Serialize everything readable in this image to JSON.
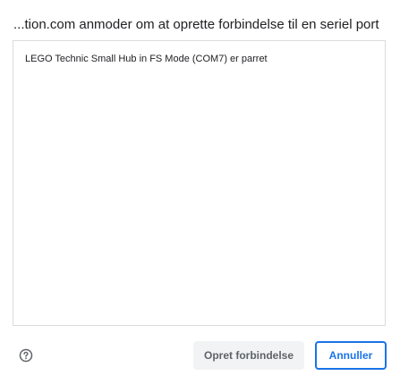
{
  "dialog": {
    "title": "...tion.com anmoder om at oprette forbindelse til en seriel port",
    "devices": [
      {
        "label": "LEGO Technic Small Hub in FS Mode (COM7) er parret"
      }
    ],
    "help_icon": "help-circle-icon",
    "connect_label": "Opret forbindelse",
    "cancel_label": "Annuller"
  },
  "colors": {
    "accent": "#1a73e8",
    "border": "#dadce0",
    "disabled_button_bg": "#f1f3f4",
    "disabled_button_text": "#5f6368",
    "text": "#202124"
  }
}
